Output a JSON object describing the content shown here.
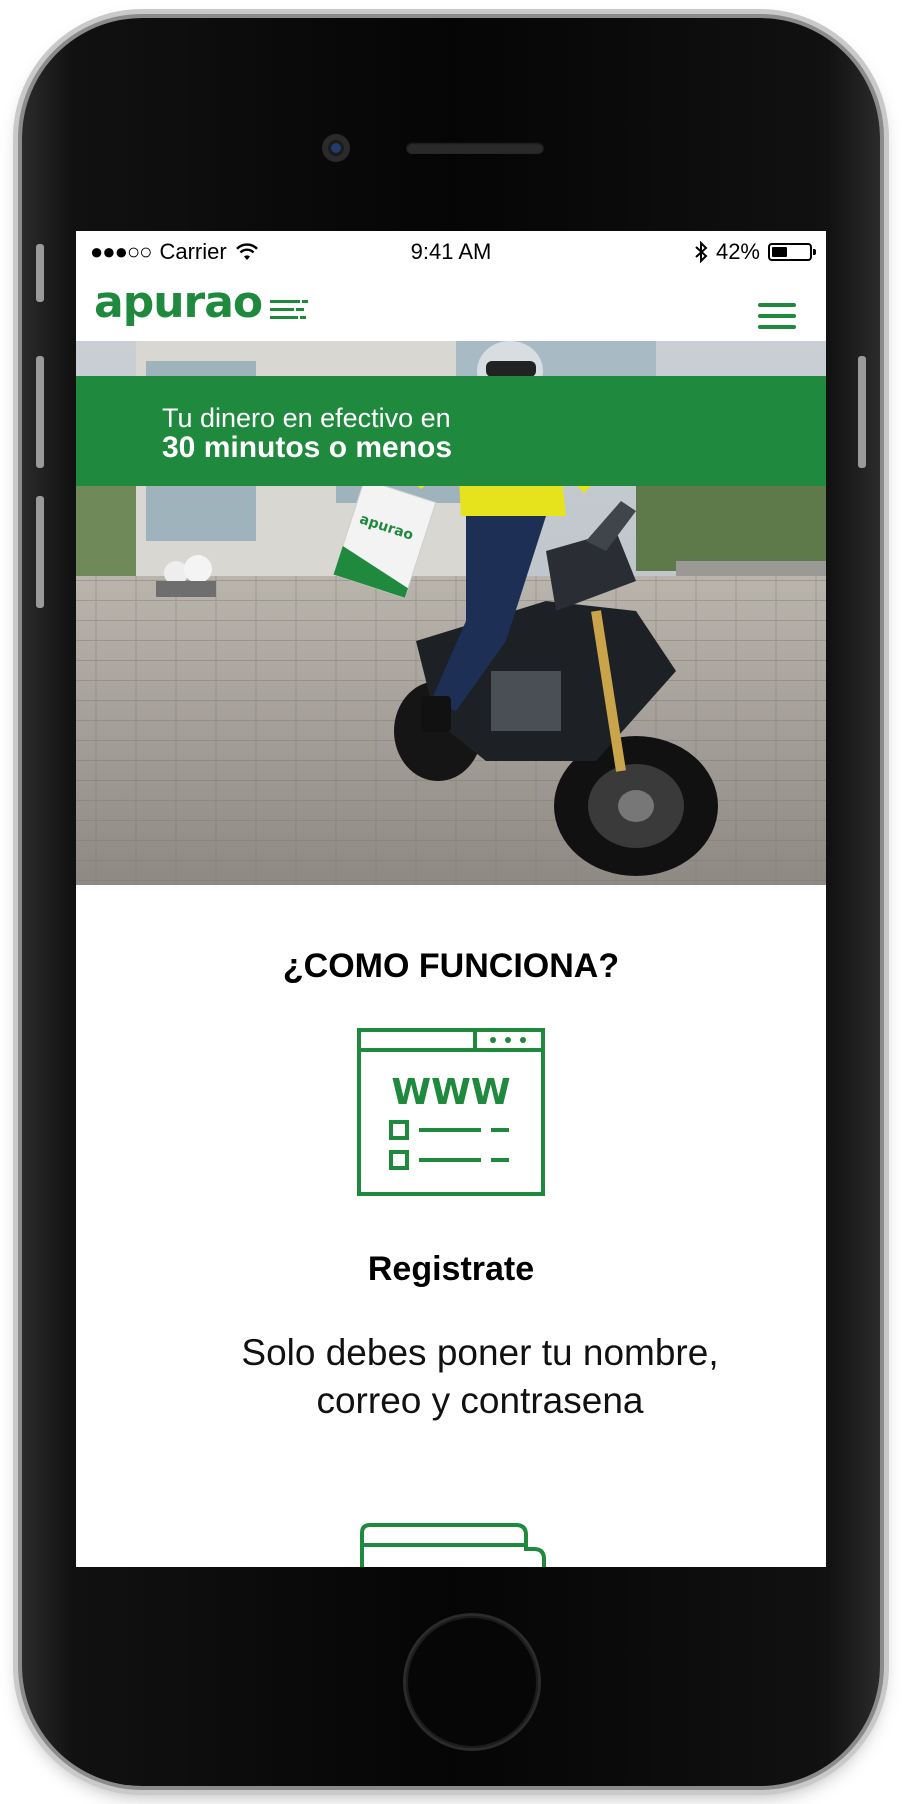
{
  "statusbar": {
    "signal": "●●●○○",
    "carrier": "Carrier",
    "time": "9:41 AM",
    "battery_percent": "42%",
    "battery_level": 0.42
  },
  "brand": {
    "logo": "apurao",
    "primary_color": "#1f8a3e",
    "banner_color": "#1f8a3e"
  },
  "nav": {
    "menu_icon": "hamburger-menu-icon"
  },
  "hero": {
    "line1": "Tu dinero en efectivo en",
    "line2": "30 minutos o menos",
    "folder_logo": "apurao"
  },
  "how_it_works": {
    "title": "¿COMO FUNCIONA?",
    "steps": [
      {
        "icon": "browser-www-icon",
        "www": "WWW",
        "title": "Registrate",
        "desc_line1": "Solo debes poner tu nombre,",
        "desc_line2": "correo y contrasena"
      },
      {
        "icon": "card-icon"
      }
    ]
  }
}
